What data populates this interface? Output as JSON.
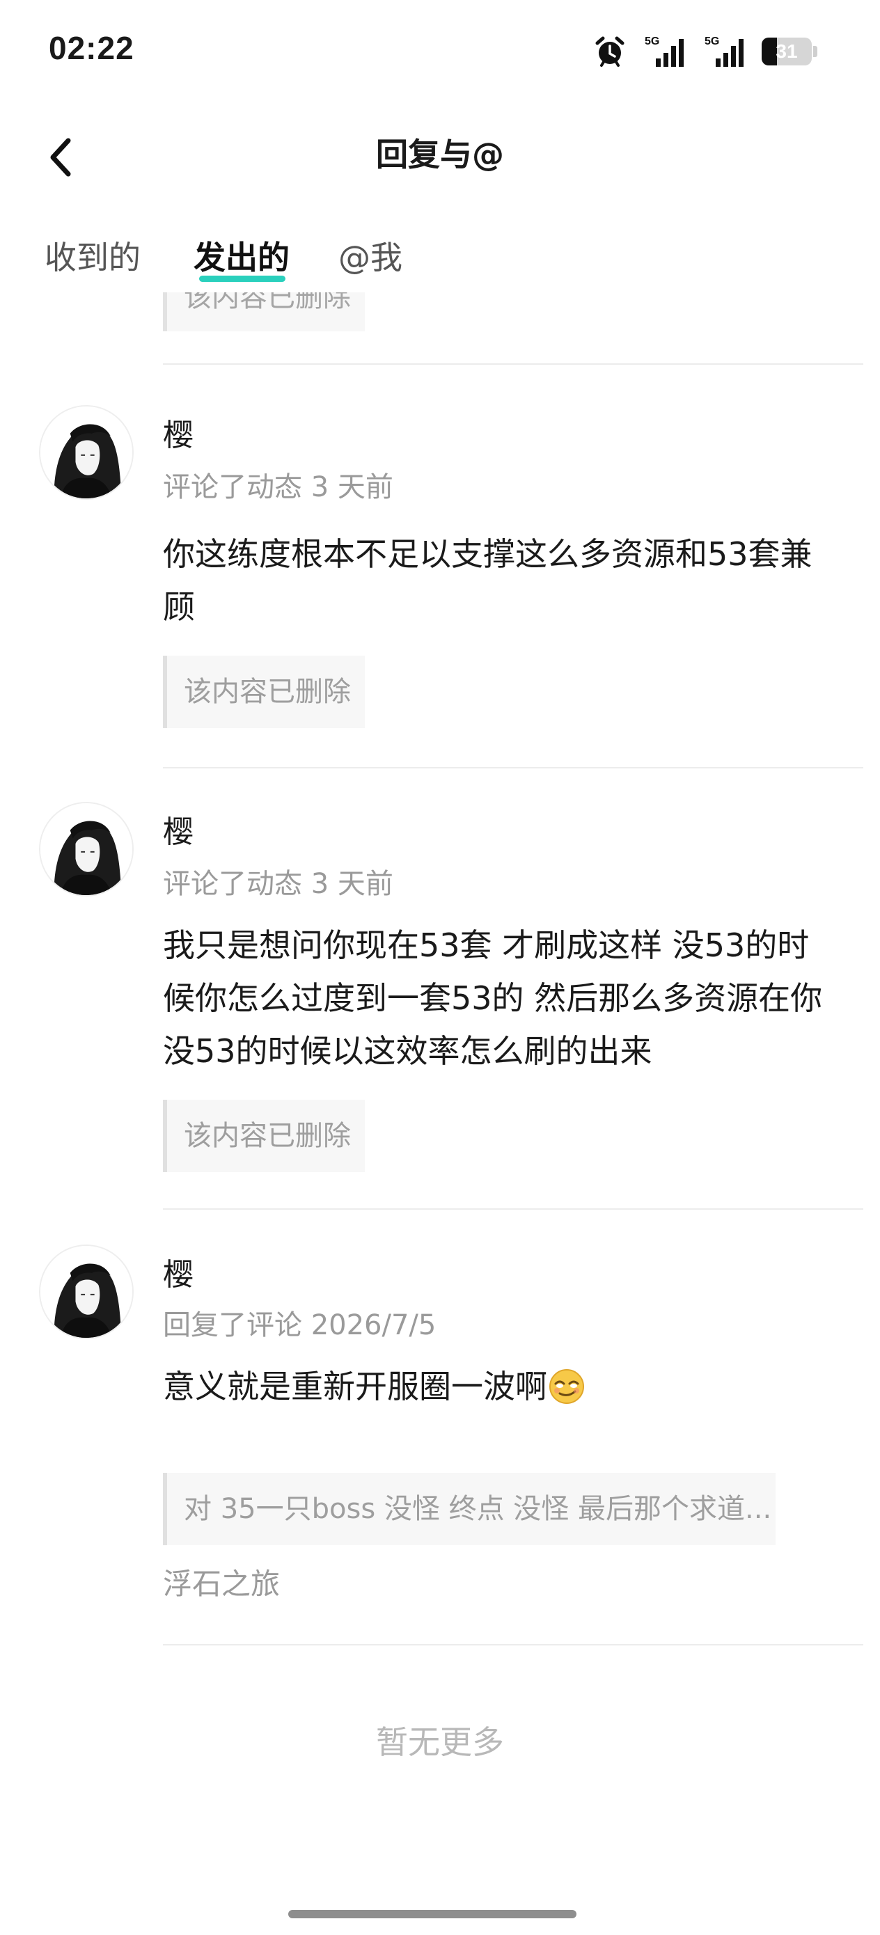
{
  "status_bar": {
    "time": "02:22",
    "alarm_icon": "alarm-clock-icon",
    "signal_1_label": "5G",
    "signal_2_label": "5G",
    "battery_level": "31",
    "battery_fraction": 0.31
  },
  "header": {
    "back_icon": "chevron-left-icon",
    "title": "回复与@"
  },
  "tabs": [
    {
      "label": "收到的",
      "active": false
    },
    {
      "label": "发出的",
      "active": true
    },
    {
      "label": "@我",
      "active": false
    }
  ],
  "accent_color": "#2ad0bd",
  "partial_item": {
    "quote_text": "该内容已删除"
  },
  "items": [
    {
      "username": "樱",
      "meta": "评论了动态 3 天前",
      "comment": "你这练度根本不足以支撑这么多资源和53套兼顾",
      "quote": "该内容已删除"
    },
    {
      "username": "樱",
      "meta": "评论了动态 3 天前",
      "comment": "我只是想问你现在53套  才刷成这样  没53的时候你怎么过度到一套53的 然后那么多资源在你没53的时候以这效率怎么刷的出来",
      "quote": "该内容已删除"
    },
    {
      "username": "樱",
      "meta": "回复了评论 2026/7/5",
      "comment": "意义就是重新开服圈一波啊",
      "emoji": "smirk-face-emoji",
      "quote": "对 35一只boss 没怪 终点 没怪 最后那个求道...",
      "source": "浮石之旅"
    }
  ],
  "footer": {
    "no_more": "暂无更多"
  }
}
